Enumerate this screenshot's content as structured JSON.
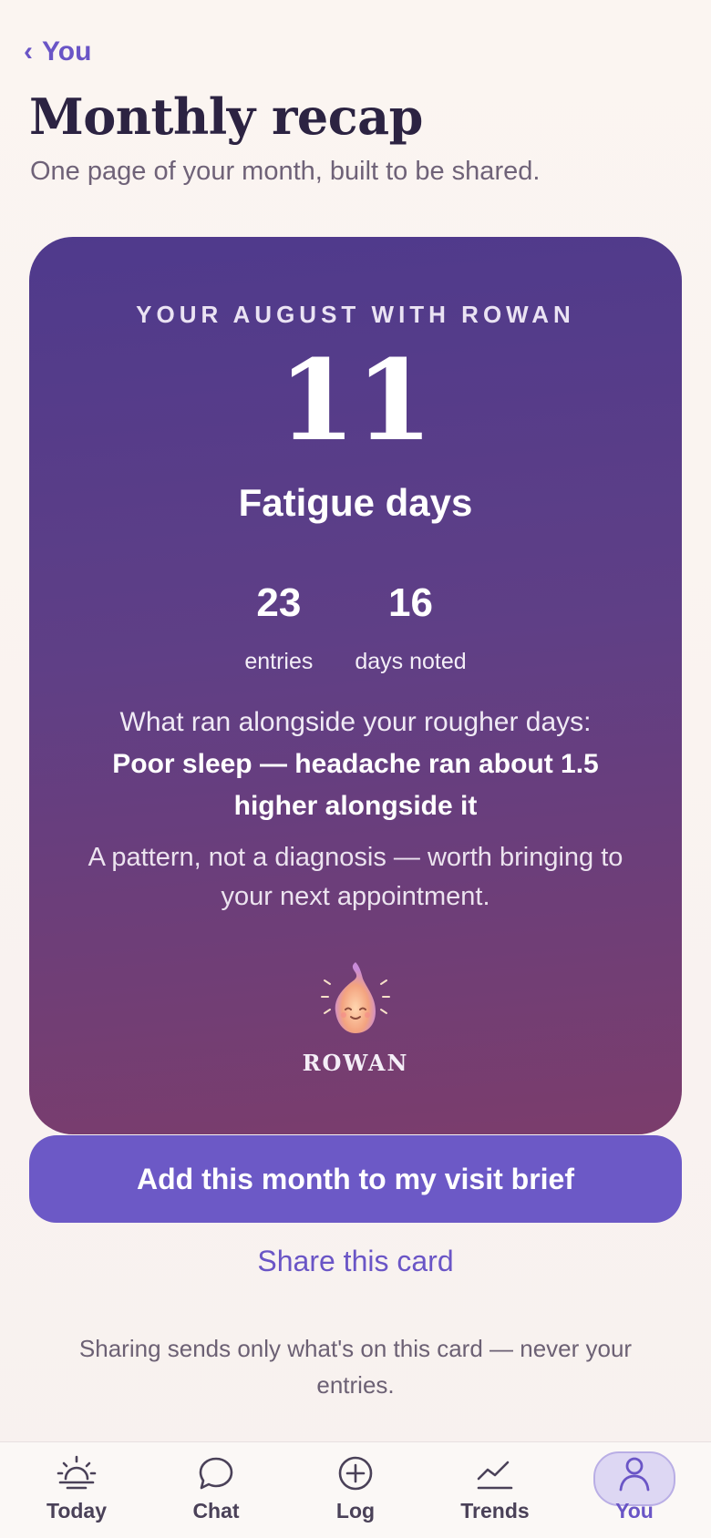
{
  "nav": {
    "back_label": "You"
  },
  "header": {
    "title": "Monthly recap",
    "subtitle": "One page of your month, built to be shared."
  },
  "card": {
    "eyebrow": "YOUR AUGUST WITH ROWAN",
    "big_number": "11",
    "big_label": "Fatigue days",
    "stats": [
      {
        "value": "23",
        "label": "entries"
      },
      {
        "value": "16",
        "label": "days noted"
      }
    ],
    "pattern_lead": "What ran alongside your rougher days:",
    "pattern_strong": "Poor sleep — headache ran about 1.5 higher alongside it",
    "disclaimer": "A pattern, not a diagnosis — worth bringing to your next appointment.",
    "signature": "ROWAN",
    "colors": {
      "gradient_top": "#4f3a8c",
      "gradient_bottom": "#7b3d6c"
    }
  },
  "actions": {
    "primary": "Add this month to my visit brief",
    "secondary": "Share this card"
  },
  "footer_note": "Sharing sends only what's on this card — never your entries.",
  "tabbar": {
    "items": [
      {
        "label": "Today",
        "icon": "sunrise-icon"
      },
      {
        "label": "Chat",
        "icon": "chat-bubble-icon"
      },
      {
        "label": "Log",
        "icon": "plus-circle-icon"
      },
      {
        "label": "Trends",
        "icon": "trend-line-icon"
      },
      {
        "label": "You",
        "icon": "person-icon",
        "active": true
      }
    ]
  },
  "colors": {
    "accent": "#6c59c6",
    "background": "#fbf5f1"
  }
}
